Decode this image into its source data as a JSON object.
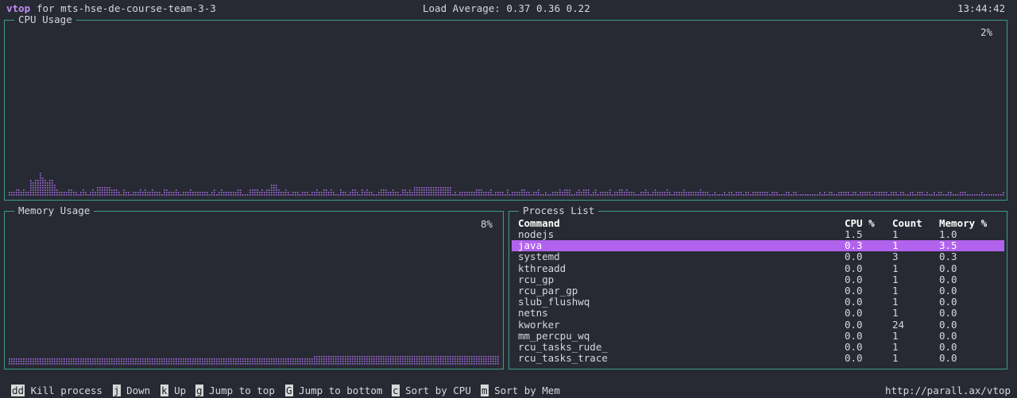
{
  "header": {
    "app": "vtop",
    "host": "for mts-hse-de-course-team-3-3",
    "load_average": "Load Average: 0.37 0.36 0.22",
    "time": "13:44:42"
  },
  "cpu": {
    "title": "CPU Usage",
    "percent_label": "2%",
    "percent": 2
  },
  "memory": {
    "title": "Memory Usage",
    "percent_label": "8%",
    "percent": 8
  },
  "process_list": {
    "title": "Process List",
    "columns": [
      "Command",
      "CPU %",
      "Count",
      "Memory %"
    ],
    "selected_index": 1,
    "rows": [
      [
        "nodejs",
        "1.5",
        "1",
        "1.0"
      ],
      [
        "java",
        "0.3",
        "1",
        "3.5"
      ],
      [
        "systemd",
        "0.0",
        "3",
        "0.3"
      ],
      [
        "kthreadd",
        "0.0",
        "1",
        "0.0"
      ],
      [
        "rcu_gp",
        "0.0",
        "1",
        "0.0"
      ],
      [
        "rcu_par_gp",
        "0.0",
        "1",
        "0.0"
      ],
      [
        "slub_flushwq",
        "0.0",
        "1",
        "0.0"
      ],
      [
        "netns",
        "0.0",
        "1",
        "0.0"
      ],
      [
        "kworker",
        "0.0",
        "24",
        "0.0"
      ],
      [
        "mm_percpu_wq",
        "0.0",
        "1",
        "0.0"
      ],
      [
        "rcu_tasks_rude_",
        "0.0",
        "1",
        "0.0"
      ],
      [
        "rcu_tasks_trace",
        "0.0",
        "1",
        "0.0"
      ]
    ]
  },
  "footer": {
    "shortcuts": [
      {
        "key": "dd",
        "label": "Kill process"
      },
      {
        "key": "j",
        "label": "Down"
      },
      {
        "key": "k",
        "label": "Up"
      },
      {
        "key": "g",
        "label": "Jump to top"
      },
      {
        "key": "G",
        "label": "Jump to bottom"
      },
      {
        "key": "c",
        "label": "Sort by CPU"
      },
      {
        "key": "m",
        "label": "Sort by Mem"
      }
    ],
    "url": "http://parall.ax/vtop"
  },
  "colors": {
    "accent": "#c18cf5",
    "border": "#3f9a8e",
    "selection": "#b263ee",
    "graph": "#a66ee0"
  }
}
